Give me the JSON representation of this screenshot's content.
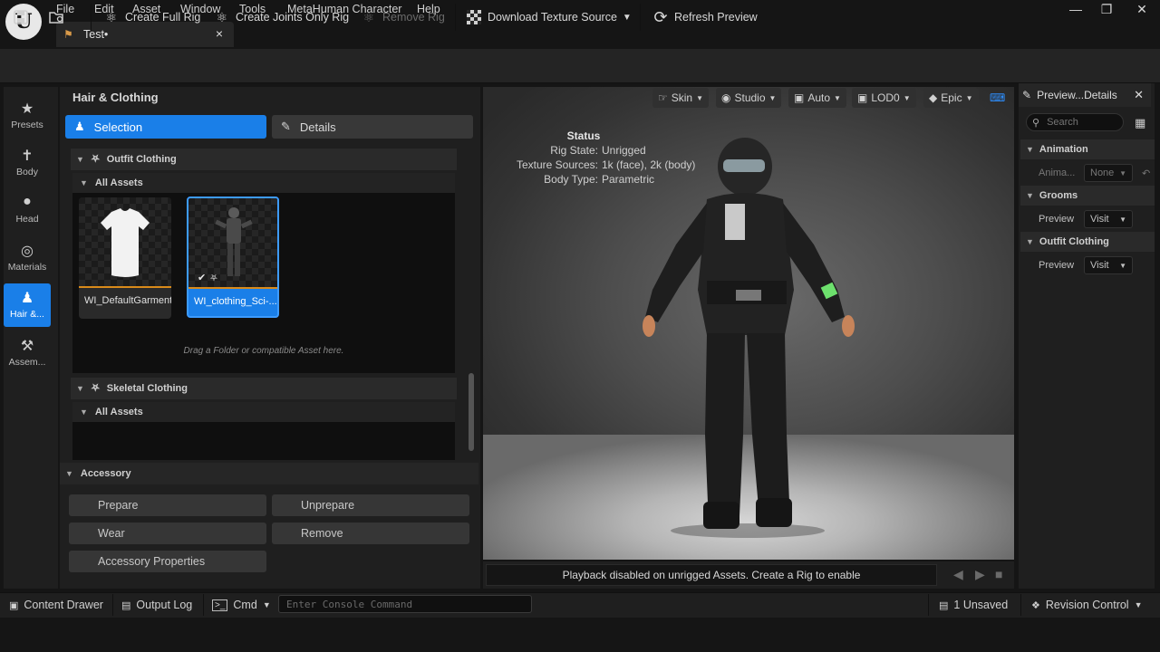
{
  "menu": [
    "File",
    "Edit",
    "Asset",
    "Window",
    "Tools",
    "MetaHuman Character",
    "Help"
  ],
  "doc_tab": {
    "title": "Test•"
  },
  "toolbar": {
    "create_full_rig": "Create Full Rig",
    "create_joints_only_rig": "Create Joints Only Rig",
    "remove_rig": "Remove Rig",
    "download_texture_source": "Download Texture Source",
    "refresh_preview": "Refresh Preview"
  },
  "leftnav": [
    {
      "label": "Presets",
      "icon": "star-icon"
    },
    {
      "label": "Body",
      "icon": "body-icon"
    },
    {
      "label": "Head",
      "icon": "head-icon"
    },
    {
      "label": "Materials",
      "icon": "materials-icon"
    },
    {
      "label": "Hair &...",
      "icon": "hair-icon"
    },
    {
      "label": "Assem...",
      "icon": "hammer-icon"
    }
  ],
  "panel": {
    "title": "Hair & Clothing",
    "tab_selection": "Selection",
    "tab_details": "Details",
    "outfit_clothing": "Outfit Clothing",
    "all_assets": "All Assets",
    "assets": [
      "WI_DefaultGarment",
      "WI_clothing_Sci-..."
    ],
    "drop_hint": "Drag a Folder or compatible Asset here.",
    "skeletal_clothing": "Skeletal Clothing",
    "accessory": "Accessory",
    "buttons": {
      "prepare": "Prepare",
      "unprepare": "Unprepare",
      "wear": "Wear",
      "remove": "Remove",
      "accessory_properties": "Accessory Properties"
    }
  },
  "viewport": {
    "pills": [
      "Skin",
      "Studio",
      "Auto",
      "LOD0",
      "Epic"
    ],
    "status_title": "Status",
    "status_rows": [
      {
        "k": "Rig State:",
        "v": "Unrigged"
      },
      {
        "k": "Texture Sources:",
        "v": "1k (face), 2k (body)"
      },
      {
        "k": "Body Type:",
        "v": "Parametric"
      }
    ],
    "playback_msg": "Playback disabled on unrigged Assets. Create a Rig to enable"
  },
  "details": {
    "tab_title": "Preview...Details",
    "search_placeholder": "Search",
    "animation": "Animation",
    "anim_label": "Anima...",
    "anim_value": "None",
    "grooms": "Grooms",
    "preview_label": "Preview",
    "visit": "Visit",
    "outfit_clothing": "Outfit Clothing"
  },
  "statusbar": {
    "content_drawer": "Content Drawer",
    "output_log": "Output Log",
    "cmd": "Cmd",
    "console_placeholder": "Enter Console Command",
    "unsaved": "1 Unsaved",
    "revision_control": "Revision Control"
  },
  "colors": {
    "accent": "#1a7fe8",
    "asset_underline": "#d98a1a",
    "panel_bg": "#1f1f1f"
  }
}
